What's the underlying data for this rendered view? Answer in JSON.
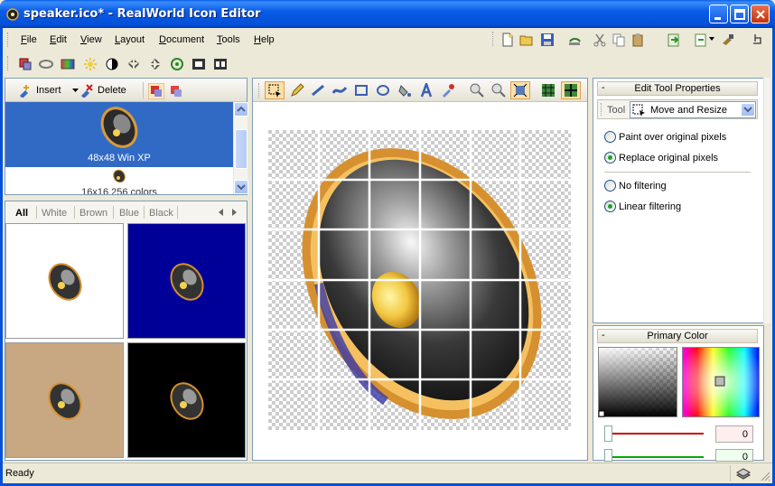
{
  "window": {
    "title": "speaker.ico* - RealWorld Icon Editor",
    "accent": "#0450d8"
  },
  "menu": [
    {
      "label": "File",
      "key": "F",
      "rest": "ile"
    },
    {
      "label": "Edit",
      "key": "E",
      "rest": "dit"
    },
    {
      "label": "View",
      "key": "V",
      "rest": "iew"
    },
    {
      "label": "Layout",
      "key": "L",
      "rest": "ayout"
    },
    {
      "label": "Document",
      "key": "D",
      "rest": "ocument"
    },
    {
      "label": "Tools",
      "key": "T",
      "rest": "ools"
    },
    {
      "label": "Help",
      "key": "H",
      "rest": "elp"
    }
  ],
  "format_panel": {
    "insert_label": "Insert",
    "delete_label": "Delete",
    "formats": [
      {
        "label": "48x48 Win XP",
        "selected": true
      },
      {
        "label": "16x16 256 colors",
        "selected": false
      }
    ]
  },
  "preview_panel": {
    "tabs": [
      "All",
      "White",
      "Brown",
      "Blue",
      "Black"
    ],
    "active_tab": "All",
    "backgrounds": [
      "#ffffff",
      "#000099",
      "#c8a882",
      "#000000"
    ]
  },
  "properties": {
    "edit_tool_header": "Edit Tool Properties",
    "tool_label": "Tool",
    "tool_value": "Move and Resize",
    "options": [
      {
        "label": "Paint over original pixels",
        "checked": false
      },
      {
        "label": "Replace original pixels",
        "checked": true
      },
      {
        "label": "No filtering",
        "checked": false
      },
      {
        "label": "Linear filtering",
        "checked": true
      }
    ],
    "primary_color_header": "Primary Color",
    "slider_values": [
      "0",
      "0"
    ]
  },
  "status": {
    "text": "Ready"
  }
}
